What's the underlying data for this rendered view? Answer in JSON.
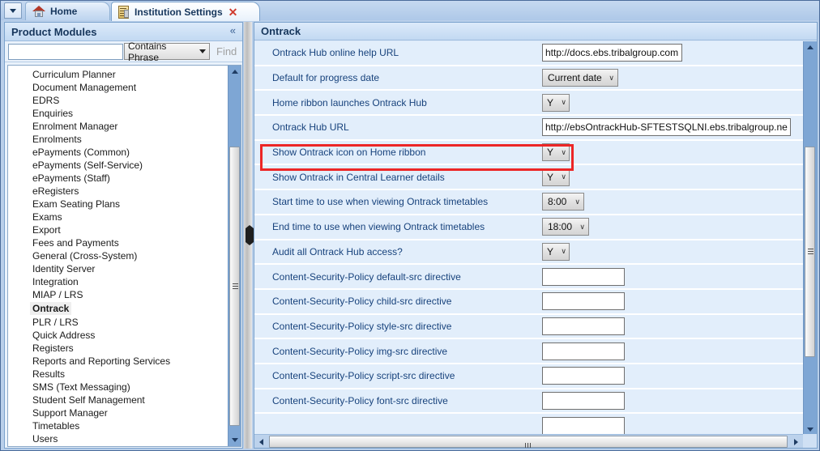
{
  "window": {
    "tabs": [
      {
        "label": "Home",
        "icon": "home-icon",
        "active": false,
        "closable": false
      },
      {
        "label": "Institution Settings",
        "icon": "document-icon",
        "active": true,
        "closable": true,
        "close_glyph": "✕"
      }
    ],
    "tab_dropdown_icon": "chevron-down-icon"
  },
  "sidebar": {
    "header": {
      "title": "Product Modules",
      "collapse_icon": "chevrons-up-icon",
      "collapse_glyph": "«"
    },
    "search": {
      "value": "",
      "placeholder": "",
      "match_mode": "Contains Phrase",
      "match_mode_icon": "triangle-down-icon",
      "find_label": "Find",
      "find_enabled": false
    },
    "selected_module": "Ontrack",
    "items": [
      "Curriculum Planner",
      "Document Management",
      "EDRS",
      "Enquiries",
      "Enrolment Manager",
      "Enrolments",
      "ePayments (Common)",
      "ePayments (Self-Service)",
      "ePayments (Staff)",
      "eRegisters",
      "Exam Seating Plans",
      "Exams",
      "Export",
      "Fees and Payments",
      "General (Cross-System)",
      "Identity Server",
      "Integration",
      "MIAP / LRS",
      "Ontrack",
      "PLR / LRS",
      "Quick Address",
      "Registers",
      "Reports and Reporting Services",
      "Results",
      "SMS (Text Messaging)",
      "Student Self Management",
      "Support Manager",
      "Timetables",
      "Users"
    ]
  },
  "main": {
    "header": {
      "title": "Ontrack"
    },
    "highlight_color": "#ec2626",
    "highlighted_setting": "Show Ontrack icon on Home ribbon",
    "settings": [
      {
        "label": "Ontrack Hub online help URL",
        "control": "text",
        "value": "http://docs.ebs.tribalgroup.com",
        "width": "w-url"
      },
      {
        "label": "Default for progress date",
        "control": "select",
        "value": "Current date",
        "width": "w-date"
      },
      {
        "label": "Home ribbon launches Ontrack Hub",
        "control": "select",
        "value": "Y",
        "width": "w-yn"
      },
      {
        "label": "Ontrack Hub URL",
        "control": "text",
        "value": "http://ebsOntrackHub-SFTESTSQLNI.ebs.tribalgroup.net/",
        "width": "w-long"
      },
      {
        "label": "Show Ontrack icon on Home ribbon",
        "control": "select",
        "value": "Y",
        "width": "w-yn",
        "highlighted": true
      },
      {
        "label": "Show Ontrack in Central Learner details",
        "control": "select",
        "value": "Y",
        "width": "w-yn"
      },
      {
        "label": "Start time to use when viewing Ontrack timetables",
        "control": "select",
        "value": "8:00",
        "width": "w-time"
      },
      {
        "label": "End time to use when viewing Ontrack timetables",
        "control": "select",
        "value": "18:00",
        "width": "w-time2"
      },
      {
        "label": "Audit all Ontrack Hub access?",
        "control": "select",
        "value": "Y",
        "width": "w-yn"
      },
      {
        "label": "Content-Security-Policy default-src directive",
        "control": "text",
        "value": "",
        "width": "w-csp"
      },
      {
        "label": "Content-Security-Policy child-src directive",
        "control": "text",
        "value": "",
        "width": "w-csp"
      },
      {
        "label": "Content-Security-Policy style-src directive",
        "control": "text",
        "value": "",
        "width": "w-csp"
      },
      {
        "label": "Content-Security-Policy img-src directive",
        "control": "text",
        "value": "",
        "width": "w-csp"
      },
      {
        "label": "Content-Security-Policy script-src directive",
        "control": "text",
        "value": "",
        "width": "w-csp"
      },
      {
        "label": "Content-Security-Policy font-src directive",
        "control": "text",
        "value": "",
        "width": "w-csp"
      },
      {
        "label": "",
        "control": "text",
        "value": "",
        "width": "w-csp"
      }
    ]
  },
  "scrollbars": {
    "up_arrow_icon": "triangle-up-icon",
    "down_arrow_icon": "triangle-down-icon",
    "left_arrow_icon": "triangle-left-icon",
    "right_arrow_icon": "triangle-right-icon"
  }
}
